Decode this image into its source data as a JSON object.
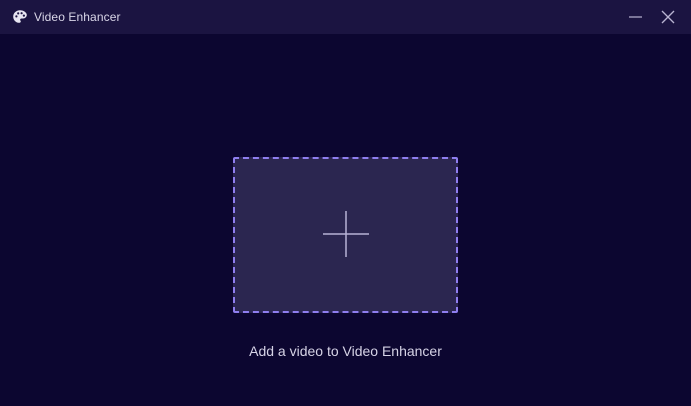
{
  "window": {
    "title": "Video Enhancer",
    "icon": "palette-icon",
    "controls": [
      "minimize-icon",
      "close-icon"
    ]
  },
  "main": {
    "dropzone_icon": "plus-icon",
    "dropzone_label": "Add a video to Video Enhancer"
  },
  "colors": {
    "background": "#0c0630",
    "titlebar": "#1b1441",
    "dropzone_fill": "#2b2650",
    "dropzone_border": "#8f7ef0",
    "text": "#d6d3e6"
  }
}
